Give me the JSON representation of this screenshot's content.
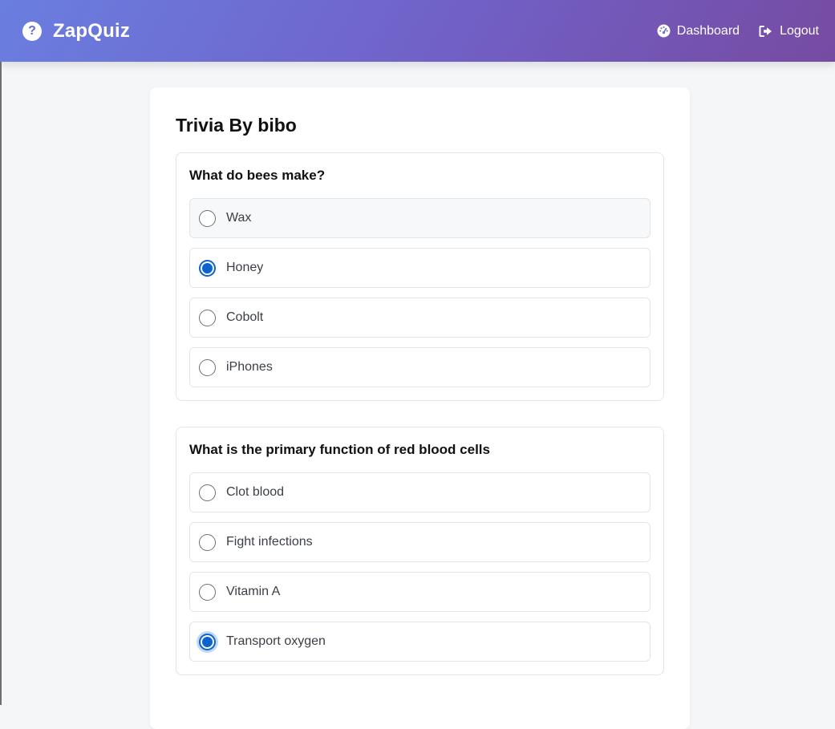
{
  "app": {
    "name": "ZapQuiz",
    "brand_icon": "question-circle-icon"
  },
  "nav": {
    "dashboard": {
      "label": "Dashboard",
      "icon": "dashboard-gauge-icon"
    },
    "logout": {
      "label": "Logout",
      "icon": "logout-arrow-icon"
    }
  },
  "quiz": {
    "title": "Trivia By bibo",
    "questions": [
      {
        "text": "What do bees make?",
        "options": [
          {
            "label": "Wax",
            "selected": false
          },
          {
            "label": "Honey",
            "selected": true
          },
          {
            "label": "Cobolt",
            "selected": false
          },
          {
            "label": "iPhones",
            "selected": false
          }
        ]
      },
      {
        "text": "What is the primary function of red blood cells",
        "options": [
          {
            "label": "Clot blood",
            "selected": false
          },
          {
            "label": "Fight infections",
            "selected": false
          },
          {
            "label": "Vitamin A",
            "selected": false
          },
          {
            "label": "Transport oxygen",
            "selected": true
          }
        ]
      }
    ]
  },
  "colors": {
    "header_gradient_start": "#6a7ee0",
    "header_gradient_end": "#764ba2",
    "accent": "#0b63d1"
  }
}
